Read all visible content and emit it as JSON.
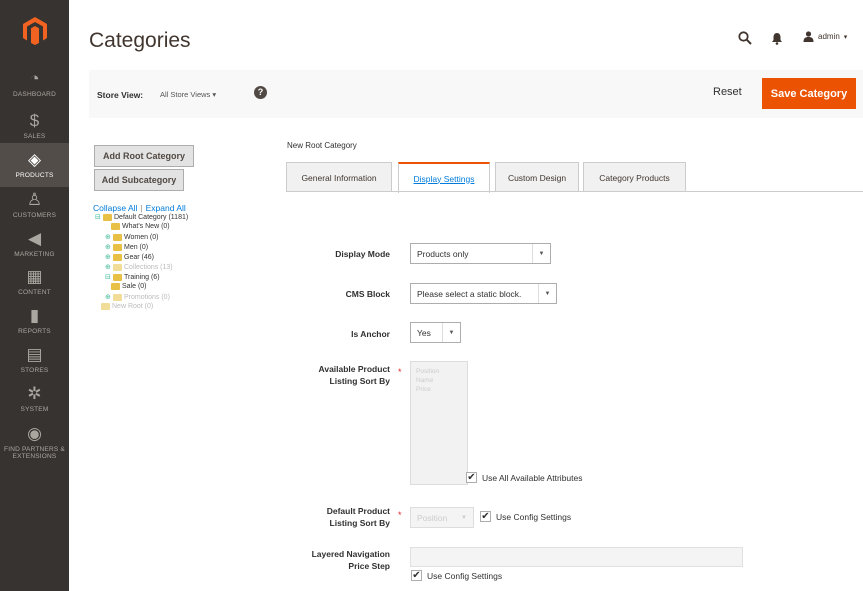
{
  "colors": {
    "sidebar_bg": "#373330",
    "accent": "#eb5202",
    "link": "#007bdb"
  },
  "sidebar": {
    "items": [
      {
        "label": "DASHBOARD",
        "icon": "dashboard-icon",
        "glyph": "◔"
      },
      {
        "label": "SALES",
        "icon": "dollar-icon",
        "glyph": "$"
      },
      {
        "label": "PRODUCTS",
        "icon": "products-icon",
        "glyph": "◈"
      },
      {
        "label": "CUSTOMERS",
        "icon": "customer-icon",
        "glyph": "♙"
      },
      {
        "label": "MARKETING",
        "icon": "megaphone-icon",
        "glyph": "◀"
      },
      {
        "label": "CONTENT",
        "icon": "content-icon",
        "glyph": "▦"
      },
      {
        "label": "REPORTS",
        "icon": "reports-icon",
        "glyph": "▮"
      },
      {
        "label": "STORES",
        "icon": "stores-icon",
        "glyph": "▤"
      },
      {
        "label": "SYSTEM",
        "icon": "gear-icon",
        "glyph": "✲"
      },
      {
        "label": "FIND PARTNERS & EXTENSIONS",
        "icon": "extensions-icon",
        "glyph": "◉"
      }
    ]
  },
  "header": {
    "title": "Categories",
    "user": "admin",
    "user_caret": "▾"
  },
  "toolbar": {
    "store_label": "Store View:",
    "store_value": "All Store Views ▾",
    "help": "?",
    "reset": "Reset",
    "save": "Save Category"
  },
  "tree": {
    "add_root": "Add Root Category",
    "add_sub": "Add Subcategory",
    "collapse_all": "Collapse All",
    "separator": "|",
    "expand_all": "Expand All",
    "nodes": [
      {
        "label": "Default Category (1181)",
        "expander": "⊟"
      },
      {
        "label": "What's New (0)",
        "expander": ""
      },
      {
        "label": "Women (0)",
        "expander": "⊕"
      },
      {
        "label": "Men (0)",
        "expander": "⊕"
      },
      {
        "label": "Gear (46)",
        "expander": "⊕"
      },
      {
        "label": "Collections (13)",
        "expander": "⊕"
      },
      {
        "label": "Training (6)",
        "expander": "⊟"
      },
      {
        "label": "Sale (0)",
        "expander": ""
      },
      {
        "label": "Promotions (0)",
        "expander": "⊕"
      },
      {
        "label": "New Root (0)",
        "expander": ""
      }
    ]
  },
  "main": {
    "section_title": "New Root Category",
    "tabs": [
      {
        "label": "General Information"
      },
      {
        "label": "Display Settings"
      },
      {
        "label": "Custom Design"
      },
      {
        "label": "Category Products"
      }
    ],
    "display_mode": {
      "label": "Display Mode",
      "value": "Products only"
    },
    "cms_block": {
      "label": "CMS Block",
      "value": "Please select a static block."
    },
    "is_anchor": {
      "label": "Is Anchor",
      "value": "Yes"
    },
    "available_sort": {
      "label_line1": "Available Product",
      "label_line2": "Listing Sort By",
      "required": "*",
      "options": [
        "Position",
        "Name",
        "Price"
      ],
      "use_all_label": "Use All Available Attributes"
    },
    "default_sort": {
      "label_line1": "Default Product",
      "label_line2": "Listing Sort By",
      "required": "*",
      "value": "Position",
      "use_config_label": "Use Config Settings"
    },
    "price_step": {
      "label_line1": "Layered Navigation",
      "label_line2": "Price Step",
      "use_config_label": "Use Config Settings"
    },
    "checkmark": "✔",
    "select_arrow": "▼"
  }
}
